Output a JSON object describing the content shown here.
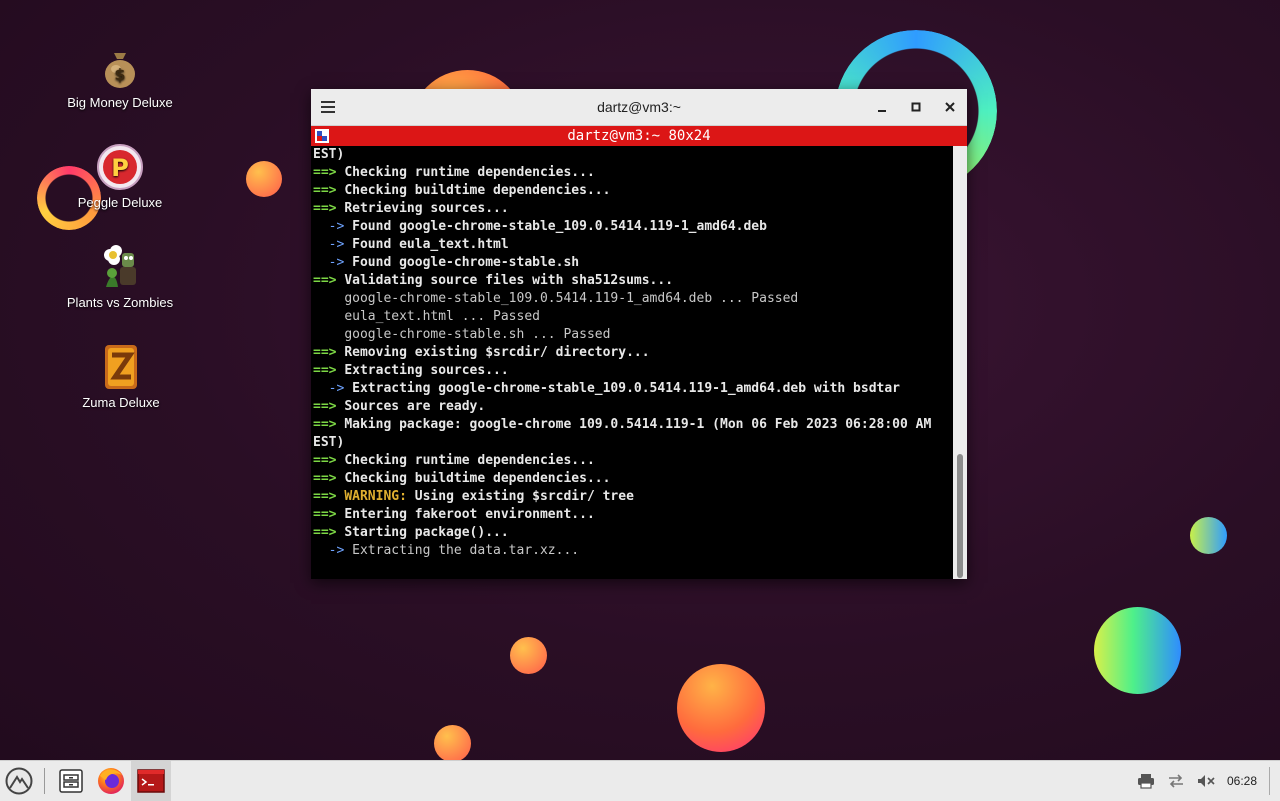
{
  "desktop": {
    "icons": [
      {
        "label": "Big Money Deluxe",
        "icon": "money-bag-icon"
      },
      {
        "label": "Peggle Deluxe",
        "icon": "peggle-icon"
      },
      {
        "label": "Plants vs Zombies",
        "icon": "plants-vs-zombies-icon"
      },
      {
        "label": "Zuma Deluxe",
        "icon": "zuma-icon"
      }
    ]
  },
  "terminal": {
    "window_title": "dartz@vm3:~",
    "subtitle": "dartz@vm3:~ 80x24",
    "lines": [
      {
        "p": "",
        "t": "EST)"
      },
      {
        "p": "==> ",
        "t": "Checking runtime dependencies..."
      },
      {
        "p": "==> ",
        "t": "Checking buildtime dependencies..."
      },
      {
        "p": "==> ",
        "t": "Retrieving sources..."
      },
      {
        "p": "  -> ",
        "t": "Found google-chrome-stable_109.0.5414.119-1_amd64.deb"
      },
      {
        "p": "  -> ",
        "t": "Found eula_text.html"
      },
      {
        "p": "  -> ",
        "t": "Found google-chrome-stable.sh"
      },
      {
        "p": "==> ",
        "t": "Validating source files with sha512sums..."
      },
      {
        "p": "    ",
        "t": "google-chrome-stable_109.0.5414.119-1_amd64.deb ... Passed"
      },
      {
        "p": "    ",
        "t": "eula_text.html ... Passed"
      },
      {
        "p": "    ",
        "t": "google-chrome-stable.sh ... Passed"
      },
      {
        "p": "==> ",
        "t": "Removing existing $srcdir/ directory..."
      },
      {
        "p": "==> ",
        "t": "Extracting sources..."
      },
      {
        "p": "  -> ",
        "t": "Extracting google-chrome-stable_109.0.5414.119-1_amd64.deb with bsdtar"
      },
      {
        "p": "==> ",
        "t": "Sources are ready."
      },
      {
        "p": "==> ",
        "t": "Making package: google-chrome 109.0.5414.119-1 (Mon 06 Feb 2023 06:28:00 AM"
      },
      {
        "p": "",
        "t": "EST)"
      },
      {
        "p": "==> ",
        "t": "Checking runtime dependencies..."
      },
      {
        "p": "==> ",
        "t": "Checking buildtime dependencies..."
      },
      {
        "p": "==> ",
        "w": "WARNING:",
        "t": " Using existing $srcdir/ tree"
      },
      {
        "p": "==> ",
        "t": "Entering fakeroot environment..."
      },
      {
        "p": "==> ",
        "t": "Starting package()..."
      },
      {
        "p": "  -> ",
        "t": "Extracting the data.tar.xz..."
      }
    ]
  },
  "taskbar": {
    "launchers": [
      "app-menu-icon",
      "file-manager-icon",
      "firefox-icon",
      "terminal-icon"
    ],
    "tray": [
      "printer-icon",
      "network-icon",
      "volume-muted-icon"
    ],
    "clock": "06:28"
  }
}
